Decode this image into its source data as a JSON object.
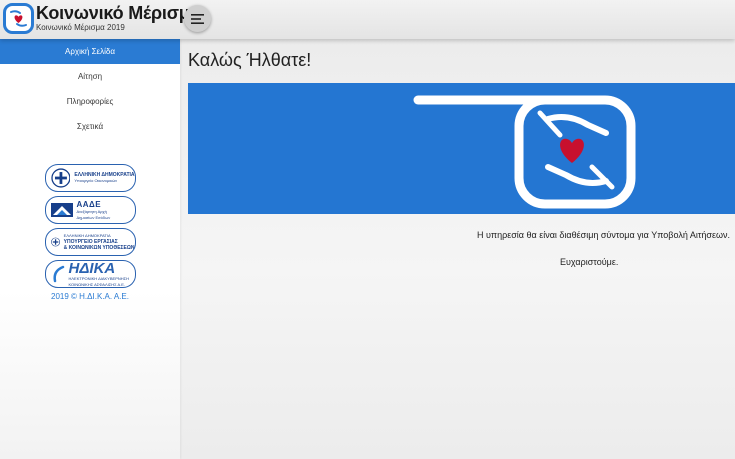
{
  "header": {
    "title": "Κοινωνικό Μέρισμα",
    "subtitle": "Κοινωνικό Μέρισμα 2019"
  },
  "sidebar": {
    "items": [
      {
        "label": "Αρχική Σελίδα",
        "active": true
      },
      {
        "label": "Αίτηση",
        "active": false
      },
      {
        "label": "Πληροφορίες",
        "active": false
      },
      {
        "label": "Σχετικά",
        "active": false
      }
    ],
    "partners": {
      "hellenic_republic": {
        "main": "ΕΛΛΗΝΙΚΗ ΔΗΜΟΚΡΑΤΙΑ",
        "sub": "Υπουργείο Οικονομικών"
      },
      "aade": {
        "main": "ΑΑΔΕ",
        "sub1": "Ανεξάρτητη Αρχή",
        "sub2": "Δημοσίων Εσόδων"
      },
      "labour_ministry": {
        "top": "ΕΛΛΗΝΙΚΗ ΔΗΜΟΚΡΑΤΙΑ",
        "main1": "ΥΠΟΥΡΓΕΙΟ ΕΡΓΑΣΙΑΣ",
        "main2": "& ΚΟΙΝΩΝΙΚΩΝ ΥΠΟΘΕΣΕΩΝ"
      },
      "idika": {
        "main": "ΗΔΙΚΑ",
        "sub1": "ΗΛΕΚΤΡΟΝΙΚΗ ΔΙΑΚΥΒΕΡΝΗΣΗ",
        "sub2": "ΚΟΙΝΩΝΙΚΗΣ ΑΣΦΑΛΙΣΗΣ Α.Ε."
      }
    },
    "copyright": "2019 © Η.ΔΙ.Κ.Α. Α.Ε."
  },
  "main": {
    "welcome": "Καλώς Ήλθατε!",
    "notice": "Η υπηρεσία θα είναι διαθέσιμη σύντομα για Υποβολή Αιτήσεων.",
    "thanks": "Ευχαριστούμε."
  },
  "icons": {
    "logo": "hands-heart-icon",
    "menu": "hamburger-icon",
    "banner": "hands-heart-icon"
  },
  "colors": {
    "accent": "#2a7bd3",
    "banner": "#2476d2",
    "heart": "#c8102e"
  }
}
